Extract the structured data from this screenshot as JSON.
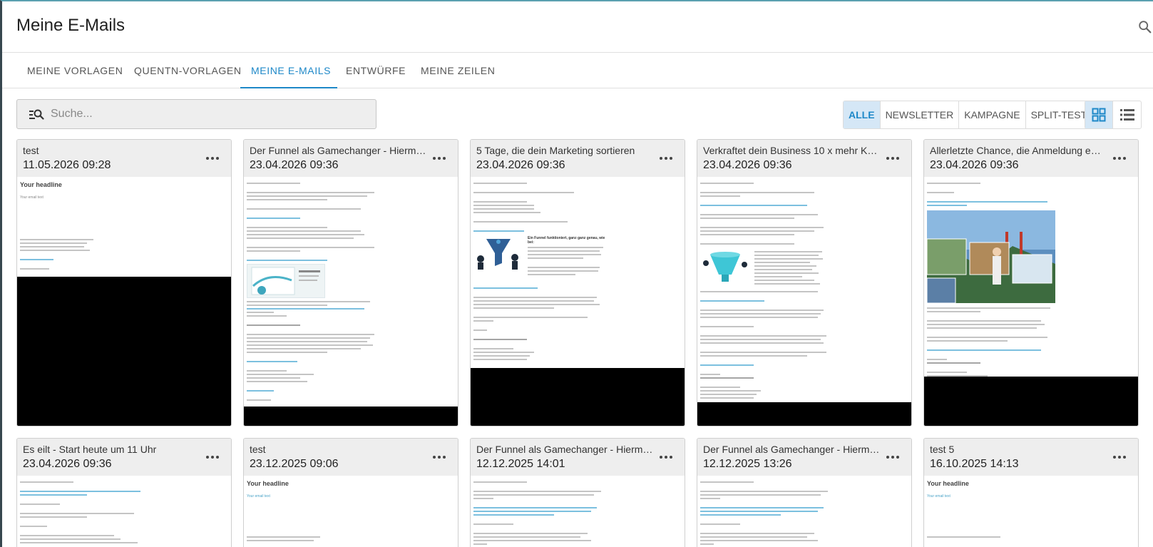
{
  "header": {
    "title": "Meine E-Mails"
  },
  "tabs": [
    {
      "label": "MEINE VORLAGEN",
      "active": false
    },
    {
      "label": "QUENTN-VORLAGEN",
      "active": false
    },
    {
      "label": "MEINE E-MAILS",
      "active": true
    },
    {
      "label": "ENTWÜRFE",
      "active": false
    },
    {
      "label": "MEINE ZEILEN",
      "active": false
    }
  ],
  "search": {
    "placeholder": "Suche...",
    "value": ""
  },
  "filters": [
    {
      "label": "ALLE",
      "active": true
    },
    {
      "label": "NEWSLETTER",
      "active": false
    },
    {
      "label": "KAMPAGNE",
      "active": false
    },
    {
      "label": "SPLIT-TEST",
      "active": false
    }
  ],
  "view": {
    "active": "grid"
  },
  "colors": {
    "accent": "#1e88c8",
    "active_bg": "#d5e7f6",
    "card_head": "#eeeeee"
  },
  "emails": [
    {
      "title": "test",
      "date": "11.05.2026 09:28",
      "preview_headline": "Your headline",
      "preview_sub": "Your email text"
    },
    {
      "title": "Der Funnel als Gamechanger - Hierm…",
      "date": "23.04.2026 09:36"
    },
    {
      "title": "5 Tage, die dein Marketing sortieren",
      "date": "23.04.2026 09:36",
      "preview_box_title": "Ein Funnel funktioniert, ganz ganz genau, wie bei:"
    },
    {
      "title": "Verkraftet dein Business 10 x mehr K…",
      "date": "23.04.2026 09:36"
    },
    {
      "title": "Allerletzte Chance, die Anmeldung e…",
      "date": "23.04.2026 09:36"
    },
    {
      "title": "Es eilt - Start heute um 11 Uhr",
      "date": "23.04.2026 09:36"
    },
    {
      "title": "test",
      "date": "23.12.2025 09:06",
      "preview_headline": "Your headline",
      "preview_sub": "Your email text"
    },
    {
      "title": "Der Funnel als Gamechanger - Hierm…",
      "date": "12.12.2025 14:01"
    },
    {
      "title": "Der Funnel als Gamechanger - Hierm…",
      "date": "12.12.2025 13:26"
    },
    {
      "title": "test 5",
      "date": "16.10.2025 14:13",
      "preview_headline": "Your headline",
      "preview_sub": "Your email text"
    }
  ]
}
